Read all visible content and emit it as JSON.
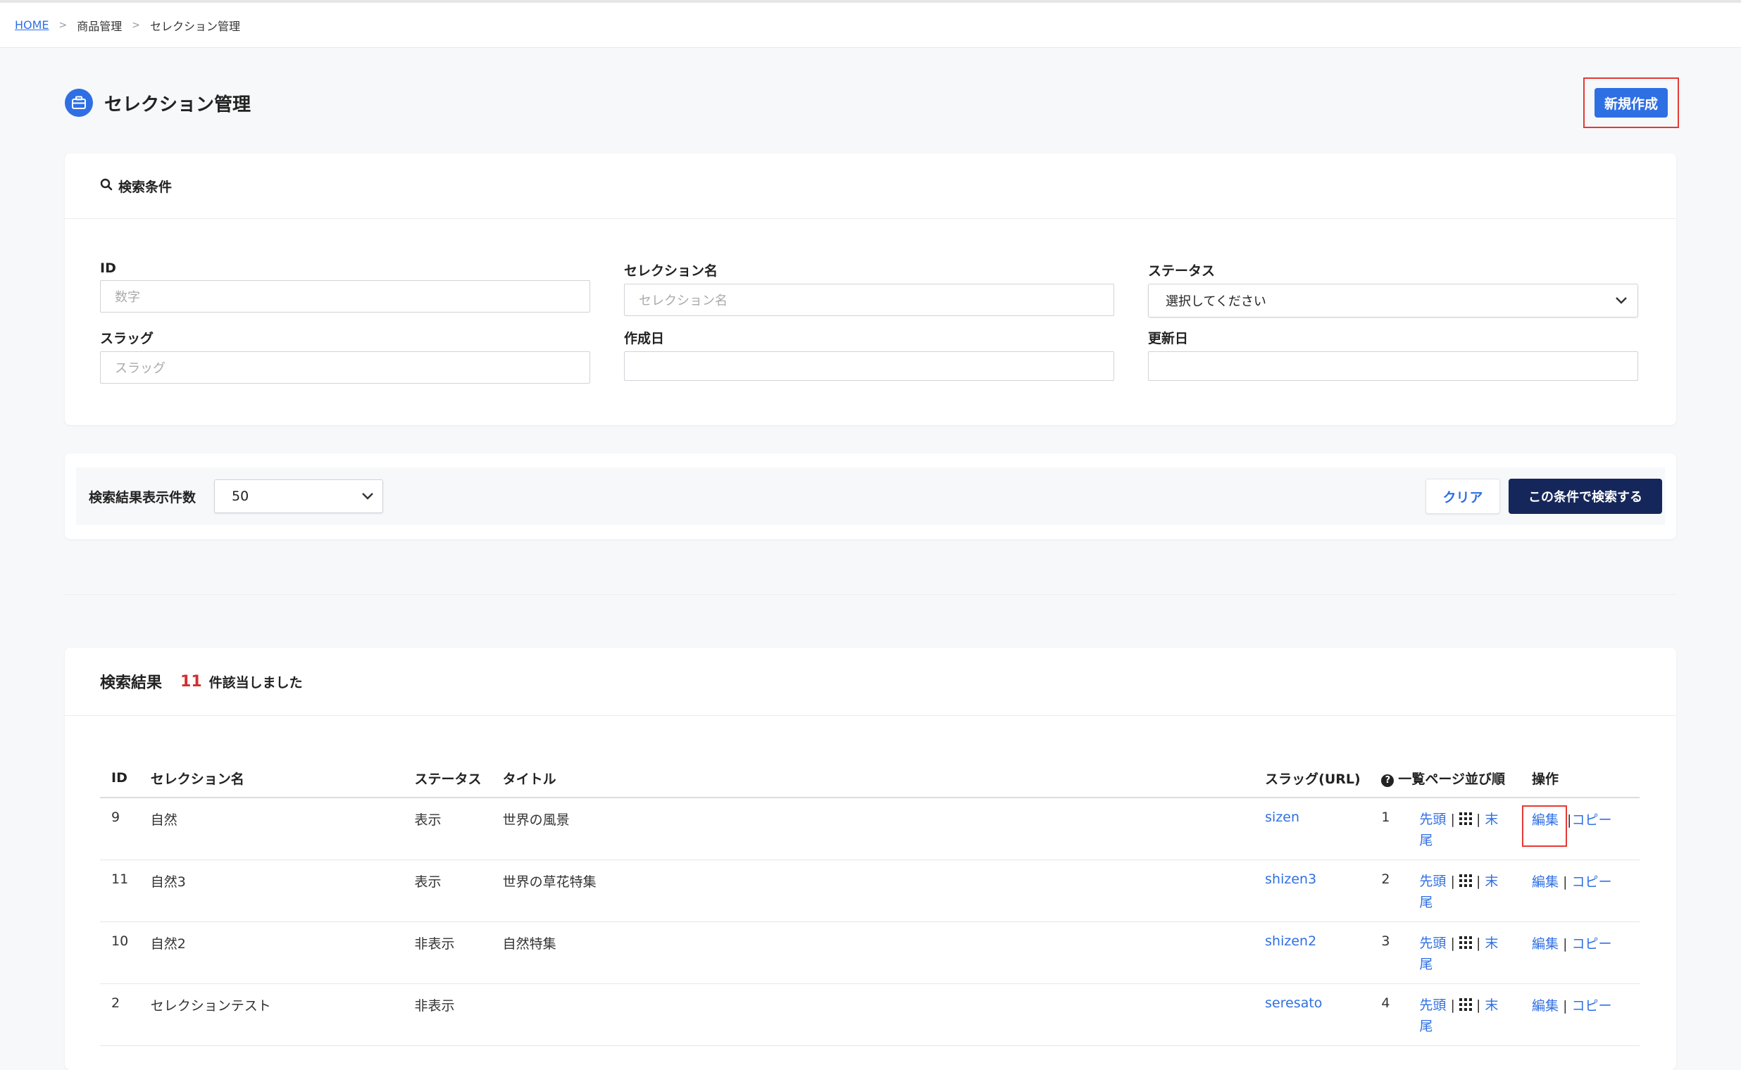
{
  "breadcrumb": {
    "home": "HOME",
    "sep": ">",
    "products": "商品管理",
    "current": "セレクション管理"
  },
  "page": {
    "title": "セレクション管理",
    "new_button": "新規作成"
  },
  "search": {
    "heading": "検索条件",
    "fields": {
      "id": {
        "label": "ID",
        "placeholder": "数字"
      },
      "name": {
        "label": "セレクション名",
        "placeholder": "セレクション名"
      },
      "status": {
        "label": "ステータス",
        "value": "選択してください"
      },
      "slug": {
        "label": "スラッグ",
        "placeholder": "スラッグ"
      },
      "created": {
        "label": "作成日",
        "placeholder": ""
      },
      "updated": {
        "label": "更新日",
        "placeholder": ""
      }
    }
  },
  "toolbar": {
    "count_label": "検索結果表示件数",
    "count_value": "50",
    "clear": "クリア",
    "search": "この条件で検索する"
  },
  "results": {
    "title": "検索結果",
    "count": "11",
    "suffix": "件該当しました",
    "columns": {
      "id": "ID",
      "name": "セレクション名",
      "status": "ステータス",
      "title": "タイトル",
      "slug": "スラッグ(URL)",
      "order": "一覧ページ並び順",
      "ops": "操作"
    },
    "links": {
      "first": "先頭",
      "last": "末尾",
      "edit": "編集",
      "copy": "コピー",
      "sep": "|"
    },
    "rows": [
      {
        "id": "9",
        "name": "自然",
        "status": "表示",
        "title": "世界の風景",
        "slug": "sizen",
        "order": "1"
      },
      {
        "id": "11",
        "name": "自然3",
        "status": "表示",
        "title": "世界の草花特集",
        "slug": "shizen3",
        "order": "2"
      },
      {
        "id": "10",
        "name": "自然2",
        "status": "非表示",
        "title": "自然特集",
        "slug": "shizen2",
        "order": "3"
      },
      {
        "id": "2",
        "name": "セレクションテスト",
        "status": "非表示",
        "title": "",
        "slug": "seresato",
        "order": "4"
      }
    ]
  },
  "colors": {
    "accent": "#2f6fe4",
    "navy": "#15275a",
    "highlight": "#e53935",
    "count": "#d32f2f"
  },
  "icons": [
    "briefcase-icon",
    "search-icon",
    "chevron-down-icon",
    "question-circle-icon",
    "grid-icon"
  ]
}
